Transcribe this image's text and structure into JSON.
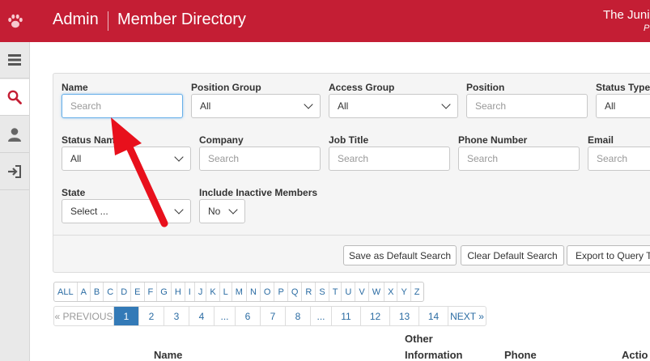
{
  "header": {
    "brand": "Admin",
    "title": "Member Directory",
    "org_name": "The Juni",
    "org_sub": "P"
  },
  "sidebar": {
    "items": [
      {
        "icon": "menu-icon"
      },
      {
        "icon": "search-icon",
        "active": true
      },
      {
        "icon": "user-icon"
      },
      {
        "icon": "logout-icon"
      }
    ]
  },
  "filters": {
    "name": {
      "label": "Name",
      "placeholder": "Search"
    },
    "position_group": {
      "label": "Position Group",
      "value": "All"
    },
    "access_group": {
      "label": "Access Group",
      "value": "All"
    },
    "position": {
      "label": "Position",
      "placeholder": "Search"
    },
    "status_type": {
      "label": "Status Type",
      "value": "All"
    },
    "status_name": {
      "label": "Status Name",
      "value": "All"
    },
    "company": {
      "label": "Company",
      "placeholder": "Search"
    },
    "job_title": {
      "label": "Job Title",
      "placeholder": "Search"
    },
    "phone_number": {
      "label": "Phone Number",
      "placeholder": "Search"
    },
    "email": {
      "label": "Email",
      "placeholder": "Search"
    },
    "state": {
      "label": "State",
      "value": "Select ..."
    },
    "include_inactive": {
      "label": "Include Inactive Members",
      "value": "No"
    }
  },
  "buttons": {
    "save_default": "Save as Default Search",
    "clear_default": "Clear Default Search",
    "export": "Export to Query To"
  },
  "alphabet": [
    "ALL",
    "A",
    "B",
    "C",
    "D",
    "E",
    "F",
    "G",
    "H",
    "I",
    "J",
    "K",
    "L",
    "M",
    "N",
    "O",
    "P",
    "Q",
    "R",
    "S",
    "T",
    "U",
    "V",
    "W",
    "X",
    "Y",
    "Z"
  ],
  "pager": [
    "« PREVIOUS",
    "1",
    "2",
    "3",
    "4",
    "...",
    "6",
    "7",
    "8",
    "...",
    "11",
    "12",
    "13",
    "14",
    "NEXT »"
  ],
  "pager_active": "1",
  "table": {
    "col_name": "Name",
    "col_other_1": "Other",
    "col_other_2": "Information",
    "col_phone": "Phone",
    "col_actions": "Actio"
  },
  "colors": {
    "header_bg": "#c41e34",
    "link": "#2b6ca3",
    "active_page": "#337ab7",
    "annotation_arrow": "#e8101c"
  }
}
